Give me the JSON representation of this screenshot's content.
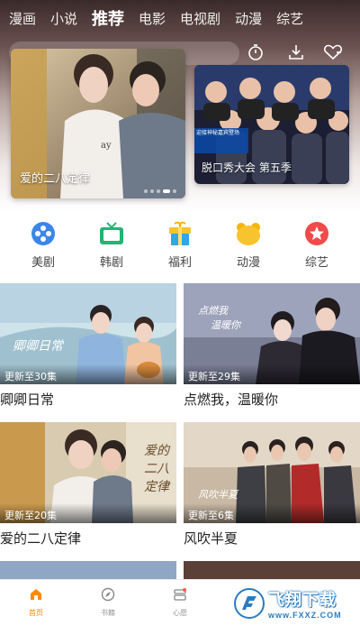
{
  "header": {
    "tabs": [
      {
        "label": "漫画",
        "active": false
      },
      {
        "label": "小说",
        "active": false
      },
      {
        "label": "推荐",
        "active": true
      },
      {
        "label": "电影",
        "active": false
      },
      {
        "label": "电视剧",
        "active": false
      },
      {
        "label": "动漫",
        "active": false
      },
      {
        "label": "综艺",
        "active": false
      }
    ],
    "tools": [
      "history-icon",
      "download-icon",
      "favorite-icon"
    ]
  },
  "banner": {
    "main": {
      "caption": "爱的二八定律"
    },
    "side": {
      "caption": "脱口秀大会 第五季"
    },
    "side_overlay": "迎接神秘嘉宾登场",
    "dots": 5,
    "active_dot": 4
  },
  "categories": [
    {
      "label": "美剧",
      "icon": "film-reel-icon",
      "color": "#3b86e8"
    },
    {
      "label": "韩剧",
      "icon": "tv-icon",
      "color": "#22b573"
    },
    {
      "label": "福利",
      "icon": "gift-icon",
      "color": "#2fa7e8"
    },
    {
      "label": "动漫",
      "icon": "bear-icon",
      "color": "#f7b500"
    },
    {
      "label": "综艺",
      "icon": "star-icon",
      "color": "#f04a4a"
    }
  ],
  "cards": [
    {
      "title": "卿卿日常",
      "badge": "更新至30集",
      "poster_text": "卿卿日常"
    },
    {
      "title": "点燃我，温暖你",
      "badge": "更新至29集",
      "poster_text": "点燃我温暖你"
    },
    {
      "title": "爱的二八定律",
      "badge": "更新至20集",
      "poster_text": "爱的二八定律"
    },
    {
      "title": "风吹半夏",
      "badge": "更新至6集",
      "poster_text": "风吹半夏"
    }
  ],
  "bottom_nav": [
    {
      "label": "首页",
      "icon": "home-icon",
      "active": true
    },
    {
      "label": "书籍",
      "icon": "compass-icon",
      "active": false
    },
    {
      "label": "心愿",
      "icon": "wish-icon",
      "active": false
    }
  ],
  "watermark": {
    "cn": "飞翔下载",
    "url": "www.FXXZ.COM"
  },
  "colors": {
    "accent": "#ff8a00",
    "text": "#222222"
  }
}
